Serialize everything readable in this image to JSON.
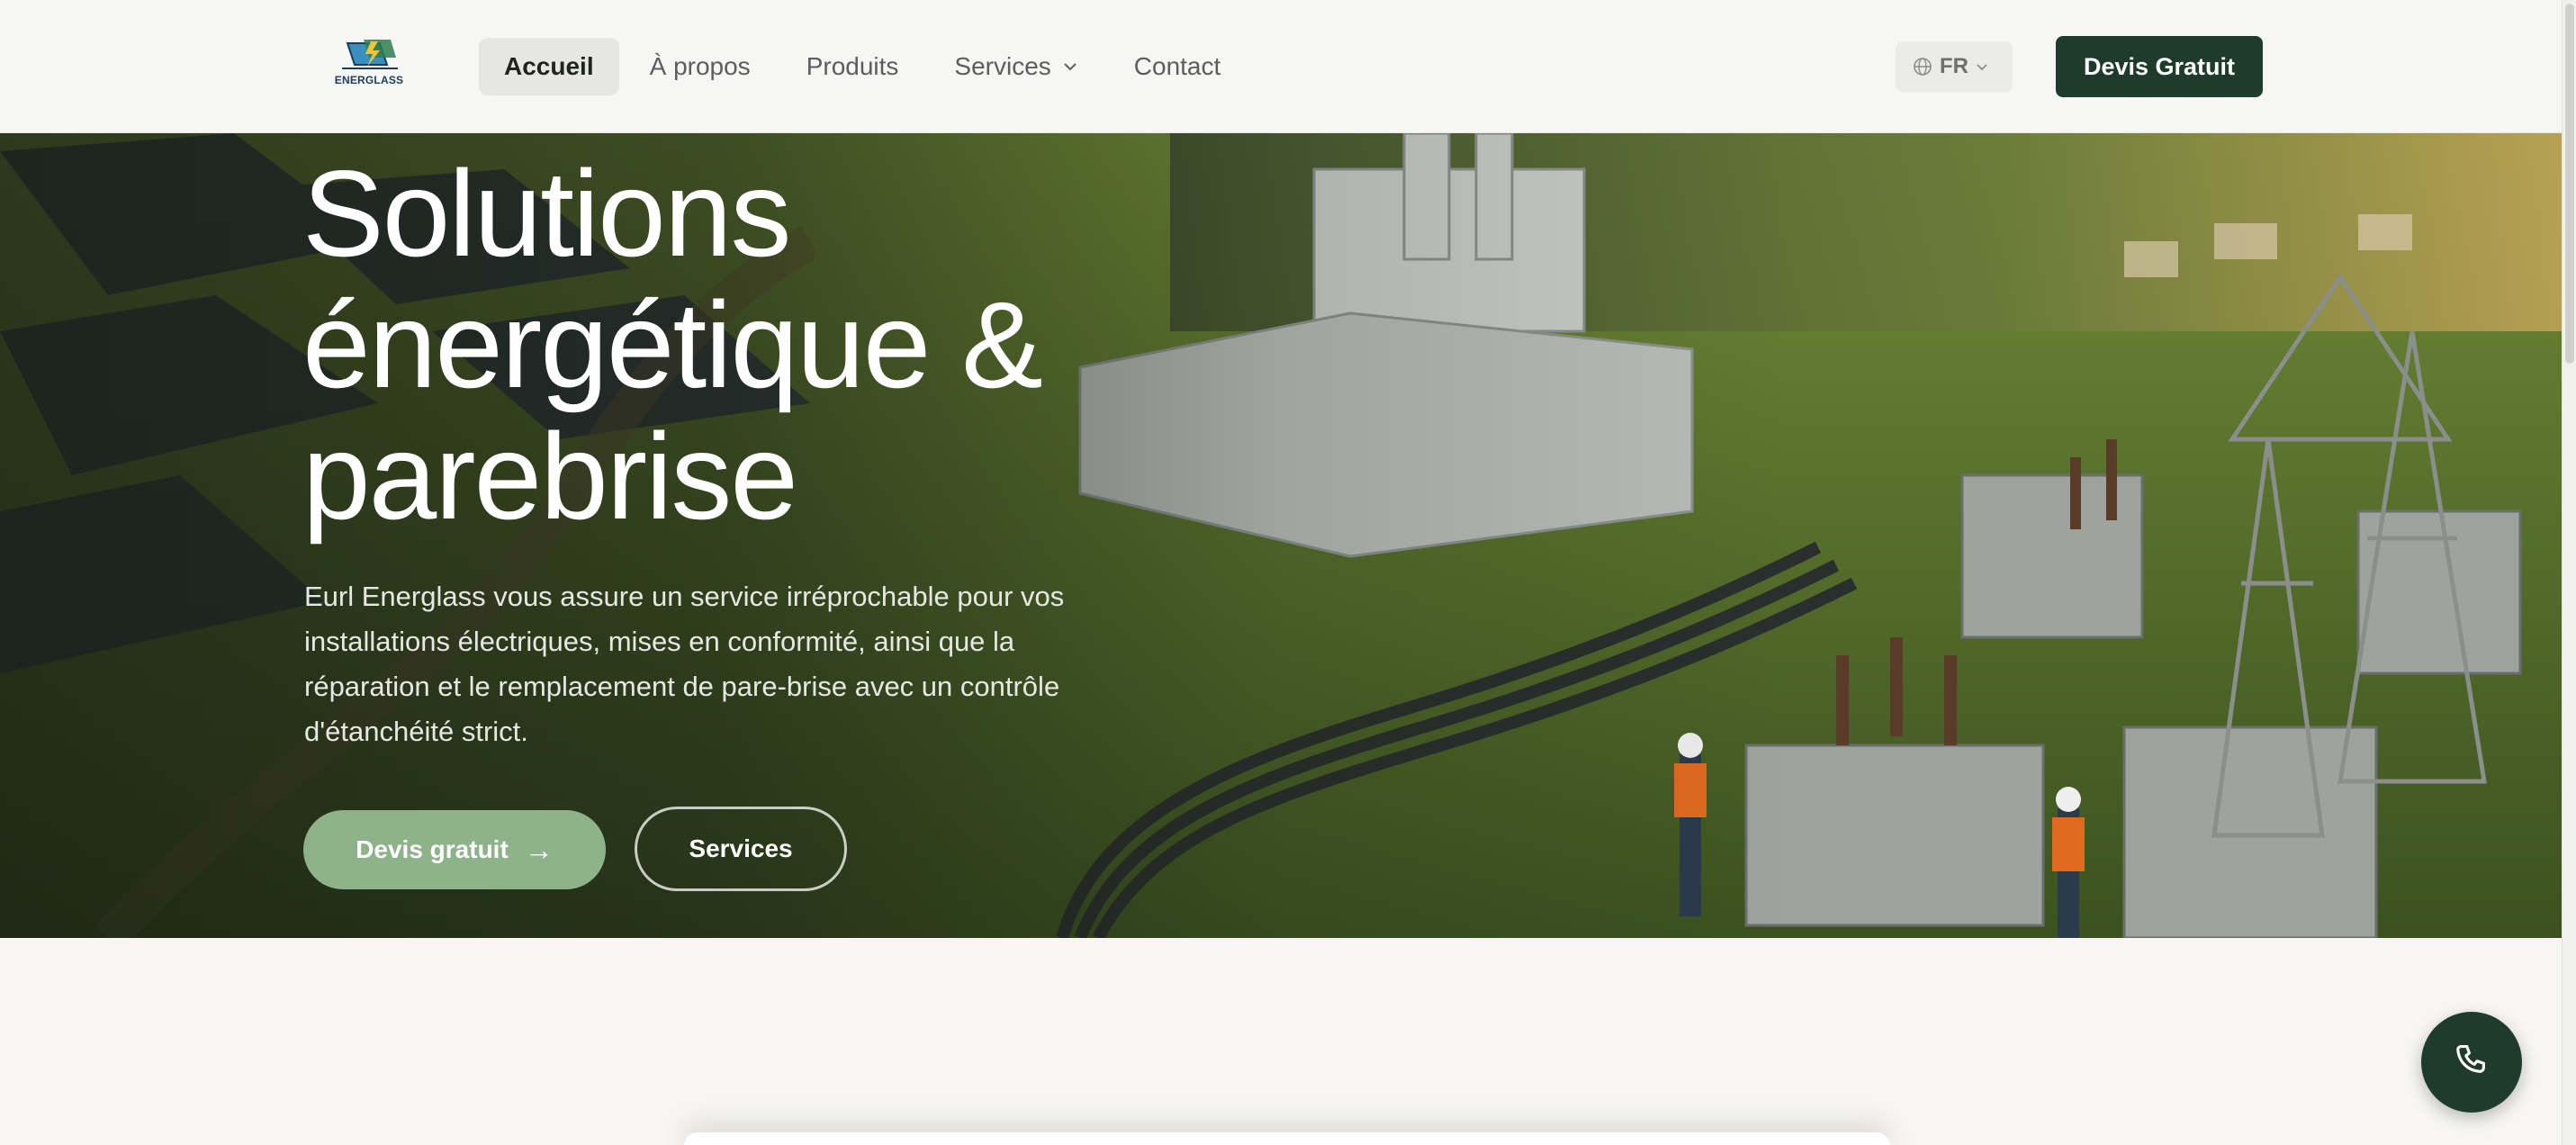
{
  "brand": {
    "logo_text": "ENERGLASS",
    "primary_color": "#1e3b2b",
    "accent_color": "#8eb28a"
  },
  "nav": {
    "items": [
      {
        "label": "Accueil",
        "active": true
      },
      {
        "label": "À propos",
        "active": false
      },
      {
        "label": "Produits",
        "active": false
      },
      {
        "label": "Services",
        "active": false,
        "has_dropdown": true
      },
      {
        "label": "Contact",
        "active": false
      }
    ]
  },
  "header": {
    "language": "FR",
    "cta_label": "Devis Gratuit"
  },
  "hero": {
    "title_line1": "Solutions",
    "title_line2": "énergétique &",
    "title_line3": "parebrise",
    "description": "Eurl Energlass vous assure un service irréprochable pour vos installations électriques, mises en conformité, ainsi que la réparation et le remplacement de pare-brise avec un contrôle d'étanchéité strict.",
    "primary_button": "Devis gratuit",
    "primary_arrow": "→",
    "secondary_button": "Services"
  },
  "icons": {
    "language": "globe-icon",
    "dropdown": "chevron-down-icon",
    "call": "phone-icon"
  }
}
